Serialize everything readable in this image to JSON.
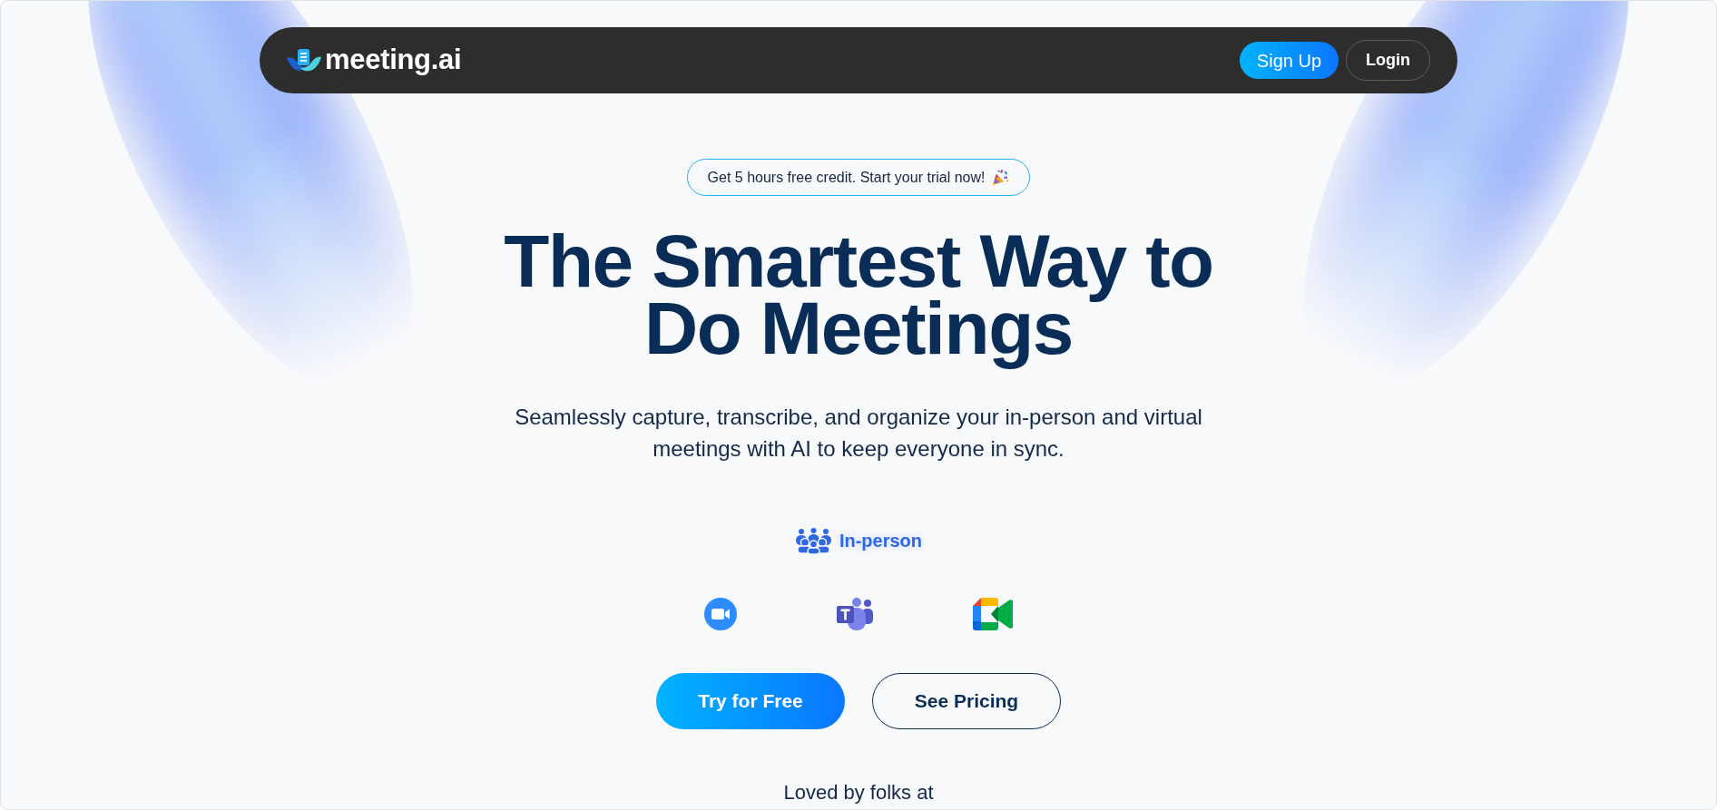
{
  "navbar": {
    "logo": "meeting.ai",
    "buttons": [
      {
        "label": "Sign Up",
        "kind": "primary"
      },
      {
        "label": "Login",
        "kind": "outline"
      }
    ]
  },
  "hero": {
    "badge": "Get 5 hours free credit. Start your trial now!",
    "title": "The Smartest Way to Do Meetings",
    "subtitle": "Seamlessly capture, transcribe, and organize your in-person and virtual meetings with AI to keep everyone in sync.",
    "mode": "In-person",
    "buttons": [
      {
        "label": "Try for Free",
        "kind": "primary"
      },
      {
        "label": "See Pricing",
        "kind": "outline"
      }
    ],
    "loved_by": "Loved by folks at"
  }
}
